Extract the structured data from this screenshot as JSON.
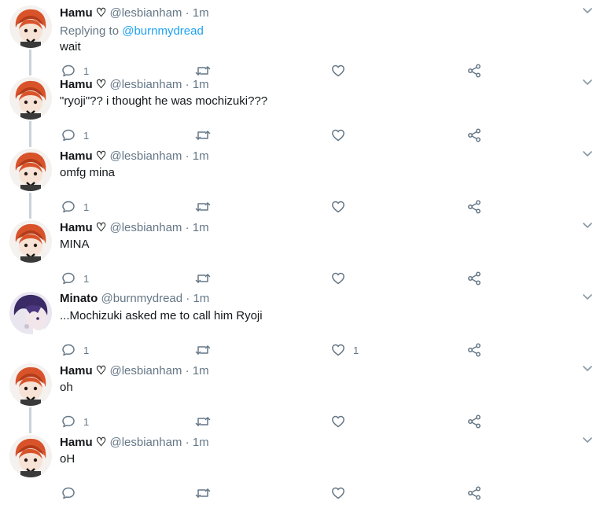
{
  "labels": {
    "replying_to": "Replying to",
    "heart": "♡",
    "dot": "·"
  },
  "tweets": [
    {
      "author": "Hamu",
      "heart_in_name": true,
      "handle": "@lesbianham",
      "time": "1m",
      "reply_to": "@burnmydread",
      "text": "wait",
      "reply_count": "1",
      "like_count": "",
      "avatar": "hamu"
    },
    {
      "author": "Hamu",
      "heart_in_name": true,
      "handle": "@lesbianham",
      "time": "1m",
      "text": "\"ryoji\"?? i thought he was mochizuki???",
      "reply_count": "1",
      "like_count": "",
      "avatar": "hamu"
    },
    {
      "author": "Hamu",
      "heart_in_name": true,
      "handle": "@lesbianham",
      "time": "1m",
      "text": "omfg mina",
      "reply_count": "1",
      "like_count": "",
      "avatar": "hamu"
    },
    {
      "author": "Hamu",
      "heart_in_name": true,
      "handle": "@lesbianham",
      "time": "1m",
      "text": "MINA",
      "reply_count": "1",
      "like_count": "",
      "avatar": "hamu"
    },
    {
      "author": "Minato",
      "heart_in_name": false,
      "handle": "@burnmydread",
      "time": "1m",
      "text": "...Mochizuki asked me to call him Ryoji",
      "reply_count": "1",
      "like_count": "1",
      "avatar": "minato"
    },
    {
      "author": "Hamu",
      "heart_in_name": true,
      "handle": "@lesbianham",
      "time": "1m",
      "text": "oh",
      "reply_count": "1",
      "like_count": "",
      "avatar": "hamu"
    },
    {
      "author": "Hamu",
      "heart_in_name": true,
      "handle": "@lesbianham",
      "time": "1m",
      "text": "oH",
      "reply_count": "",
      "like_count": "",
      "avatar": "hamu"
    }
  ],
  "colors": {
    "text": "#14171a",
    "secondary": "#657786",
    "link": "#1da1f2",
    "thread_line": "#c9d2d9"
  }
}
